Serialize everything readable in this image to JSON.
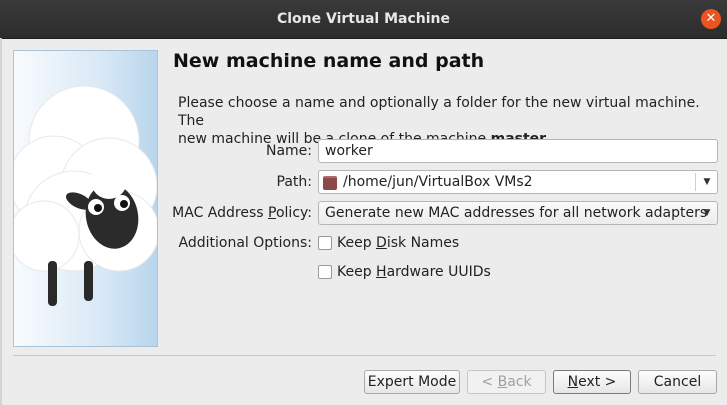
{
  "window": {
    "title": "Clone Virtual Machine"
  },
  "page": {
    "heading": "New machine name and path",
    "description_1": "Please choose a name and optionally a folder for the new virtual machine. The",
    "description_2_prefix": "new machine will be a clone of the machine ",
    "description_2_machine": "master",
    "description_2_suffix": "."
  },
  "form": {
    "name_label": "Name:",
    "name_value": "worker",
    "path_label": "Path:",
    "path_value": "/home/jun/VirtualBox VMs2",
    "mac_label_pre": "MAC Address ",
    "mac_label_key": "P",
    "mac_label_post": "olicy:",
    "mac_value": "Generate new MAC addresses for all network adapters",
    "options_label": "Additional Options:",
    "keep_disk_pre": "Keep ",
    "keep_disk_key": "D",
    "keep_disk_post": "isk Names",
    "keep_disk_checked": false,
    "keep_hw_pre": "Keep ",
    "keep_hw_key": "H",
    "keep_hw_post": "ardware UUIDs",
    "keep_hw_checked": false
  },
  "buttons": {
    "expert": "Expert Mode",
    "back_pre": "< ",
    "back_key": "B",
    "back_post": "ack",
    "next_key": "N",
    "next_post": "ext >",
    "cancel": "Cancel"
  },
  "colors": {
    "close_button": "#e95420",
    "titlebar": "#2f2f2f",
    "panel_sky": "#cfe2f3"
  }
}
